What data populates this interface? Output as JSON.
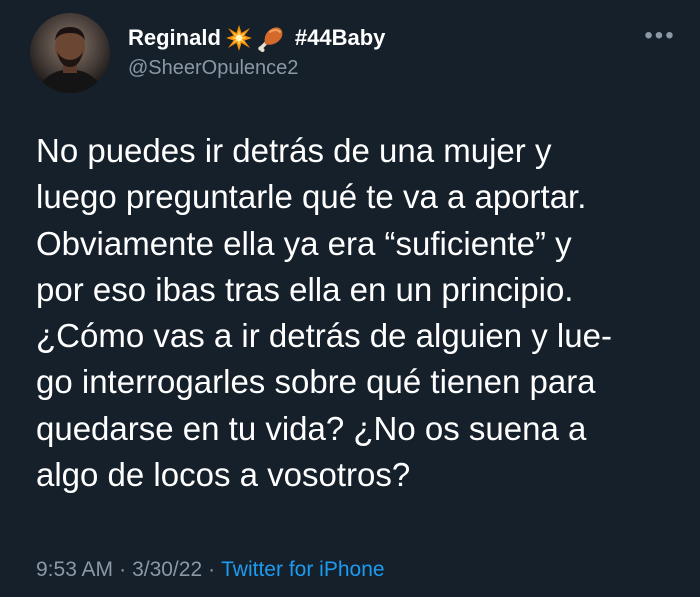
{
  "author": {
    "display_name": "Reginald",
    "hashtag": "#44Baby",
    "handle": "@SheerOpulence2",
    "name_emojis": [
      "collision-icon",
      "drumstick-icon"
    ]
  },
  "more_button": {
    "label": "•••"
  },
  "tweet": {
    "text": "No puedes ir detrás de una mujer y\nluego preguntarle qué te va a aportar.\nObviamente ella ya era “suficiente” y\npor eso ibas tras ella en un principio.\n¿Cómo vas a ir detrás de alguien y lue-\ngo interrogarles sobre qué tienen para\nquedarse en tu vida? ¿No os suena a\nalgo de locos a vosotros?"
  },
  "meta": {
    "time": "9:53 AM",
    "separator": "·",
    "date": "3/30/22",
    "source": "Twitter for iPhone"
  },
  "colors": {
    "background": "#15202b",
    "text": "#ffffff",
    "muted": "#8b98a5",
    "link": "#1d9bf0"
  }
}
